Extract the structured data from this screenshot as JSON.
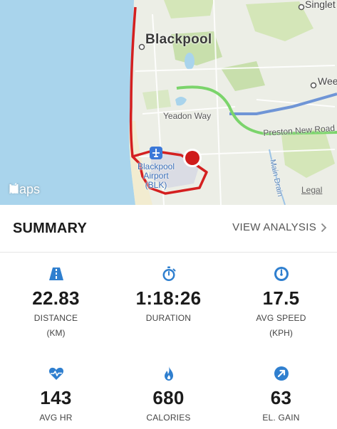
{
  "map": {
    "city_label": "Blackpool",
    "north_label": "Singlet",
    "east_label": "Wee",
    "road_1": "Yeadon Way",
    "road_2": "Preston New Road",
    "road_3": "Main Drain",
    "airport_label": "Blackpool Airport (BLK)",
    "maps_brand": "Maps",
    "legal_link": "Legal",
    "colors": {
      "sea": "#a9d4ec",
      "land": "#eceee6",
      "route": "#d42020",
      "motorway": "#6f95d6",
      "green_road": "#7bd46b",
      "parks": "#c8dfac"
    }
  },
  "summary": {
    "title": "SUMMARY",
    "view_analysis": "VIEW ANALYSIS",
    "accent_color": "#2f7fcf",
    "stats": [
      {
        "icon": "road-icon",
        "value": "22.83",
        "label": "DISTANCE",
        "unit": "(KM)"
      },
      {
        "icon": "stopwatch-icon",
        "value": "1:18:26",
        "label": "DURATION",
        "unit": ""
      },
      {
        "icon": "speedometer-icon",
        "value": "17.5",
        "label": "AVG SPEED",
        "unit": "(KPH)"
      },
      {
        "icon": "heart-rate-icon",
        "value": "143",
        "label": "AVG HR",
        "unit": ""
      },
      {
        "icon": "flame-icon",
        "value": "680",
        "label": "CALORIES",
        "unit": ""
      },
      {
        "icon": "elevation-arrow-icon",
        "value": "63",
        "label": "EL. GAIN",
        "unit": ""
      }
    ]
  }
}
